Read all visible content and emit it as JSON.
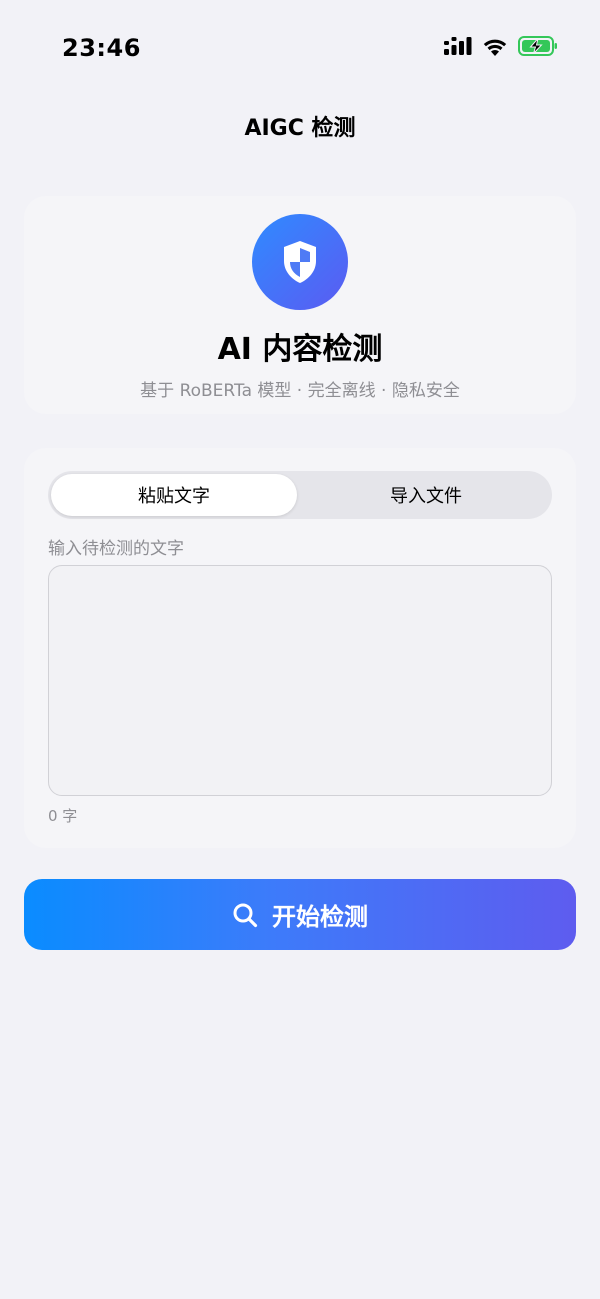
{
  "status_bar": {
    "time": "23:46",
    "icons": [
      "cellular-signal-icon",
      "wifi-icon",
      "battery-charging-icon"
    ],
    "battery_color": "#34C759"
  },
  "nav": {
    "title": "AIGC 检测"
  },
  "hero": {
    "icon": "shield-icon",
    "title": "AI 内容检测",
    "subtitle": "基于 RoBERTa 模型 · 完全离线 · 隐私安全"
  },
  "input_card": {
    "tabs": [
      {
        "label": "粘贴文字",
        "selected": true
      },
      {
        "label": "导入文件",
        "selected": false
      }
    ],
    "field_label": "输入待检测的文字",
    "text_value": "",
    "char_count": "0 字"
  },
  "action": {
    "icon": "search-icon",
    "label": "开始检测"
  },
  "colors": {
    "background": "#F2F2F7",
    "accent_start": "#0A8CFF",
    "accent_end": "#5E5CEF",
    "secondary_text": "#8E8E93"
  }
}
